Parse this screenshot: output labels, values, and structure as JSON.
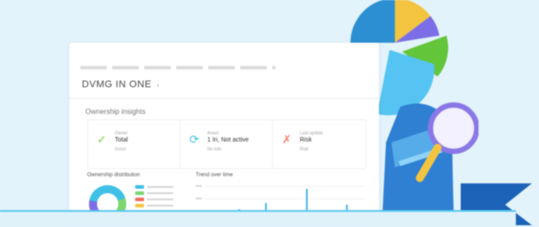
{
  "dashboard": {
    "title": "DVMG IN ONE",
    "title_caret": "›",
    "section_title": "Ownership insights",
    "stats": [
      {
        "icon": "check-icon",
        "icon_glyph": "✓",
        "color": "#7dcf3f",
        "label": "Owner",
        "value": "Total",
        "sub": "Good"
      },
      {
        "icon": "connection-icon",
        "icon_glyph": "⟳",
        "color": "#3fc0e6",
        "label": "Asset",
        "value": "1 In, Not active",
        "sub": "No info"
      },
      {
        "icon": "alert-icon",
        "icon_glyph": "✗",
        "color": "#f2856e",
        "label": "Last update",
        "value": "Risk",
        "sub": "Risk"
      }
    ],
    "panel_left_title": "Ownership distribution",
    "panel_right_title": "Trend over time",
    "legend_colors": [
      "#3fc0e6",
      "#7dd56f",
      "#f26c5c",
      "#f3c440",
      "#7b6ee6",
      "#3fc0e6"
    ],
    "bars": [
      0.25,
      0.1,
      0.4,
      0.15,
      0.55,
      0.3,
      0.2,
      0.9,
      0.35,
      0.12,
      0.5
    ]
  },
  "colors": {
    "background": "#e3f3fb",
    "accent_blue": "#2c8fd1",
    "accent_yellow": "#f3c440",
    "accent_purple": "#7b6ee6",
    "accent_green": "#63c53a",
    "accent_lightblue": "#55c4f2",
    "navy": "#1c63b7"
  },
  "decor": {
    "pie_icon": "pie-chart-icon",
    "magnifier_icon": "magnifier-icon",
    "logo_icon": "k-logo-icon"
  }
}
